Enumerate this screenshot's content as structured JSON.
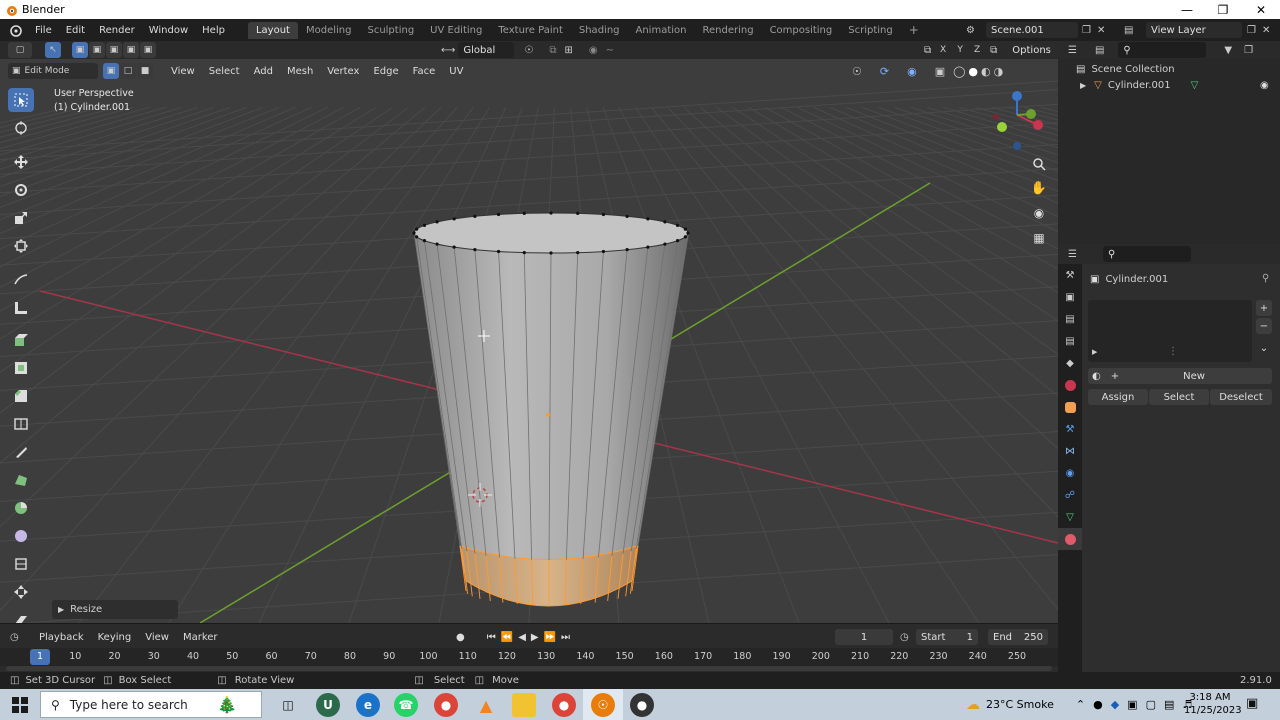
{
  "window": {
    "title": "Blender"
  },
  "menu": [
    "File",
    "Edit",
    "Render",
    "Window",
    "Help"
  ],
  "workspaces": [
    "Layout",
    "Modeling",
    "Sculpting",
    "UV Editing",
    "Texture Paint",
    "Shading",
    "Animation",
    "Rendering",
    "Compositing",
    "Scripting"
  ],
  "scene": {
    "name": "Scene.001",
    "view_layer": "View Layer"
  },
  "viewport": {
    "transform_orientation": "Global",
    "options_label": "Options",
    "mode": "Edit Mode",
    "menus": [
      "View",
      "Select",
      "Add",
      "Mesh",
      "Vertex",
      "Edge",
      "Face",
      "UV"
    ],
    "perspective_label": "User Perspective",
    "object_label": "(1) Cylinder.001",
    "gizmo_axes": [
      "X",
      "Y",
      "Z"
    ],
    "last_operator": "Resize"
  },
  "timeline": {
    "menus": [
      "Playback",
      "Keying",
      "View",
      "Marker"
    ],
    "current_frame": "1",
    "start_label": "Start",
    "start_value": "1",
    "end_label": "End",
    "end_value": "250",
    "ticks": [
      "1",
      "10",
      "20",
      "30",
      "40",
      "50",
      "60",
      "70",
      "80",
      "90",
      "100",
      "110",
      "120",
      "130",
      "140",
      "150",
      "160",
      "170",
      "180",
      "190",
      "200",
      "210",
      "220",
      "230",
      "240",
      "250"
    ]
  },
  "status_bar": {
    "items": [
      "Set 3D Cursor",
      "Box Select",
      "Rotate View",
      "Select",
      "Move"
    ],
    "version": "2.91.0"
  },
  "outliner": {
    "root": "Scene Collection",
    "items": [
      "Cylinder.001"
    ]
  },
  "properties": {
    "object_name": "Cylinder.001",
    "new_label": "New",
    "buttons": [
      "Assign",
      "Select",
      "Deselect"
    ]
  },
  "taskbar": {
    "search_placeholder": "Type here to search",
    "weather": "23°C  Smoke",
    "time": "3:18 AM",
    "date": "11/25/2023"
  },
  "colors": {
    "accent": "#4772b3",
    "selection": "#ff9a33",
    "viewport_bg": "#3d3d3d",
    "x_axis": "#a8344a",
    "y_axis": "#6ea02e"
  }
}
